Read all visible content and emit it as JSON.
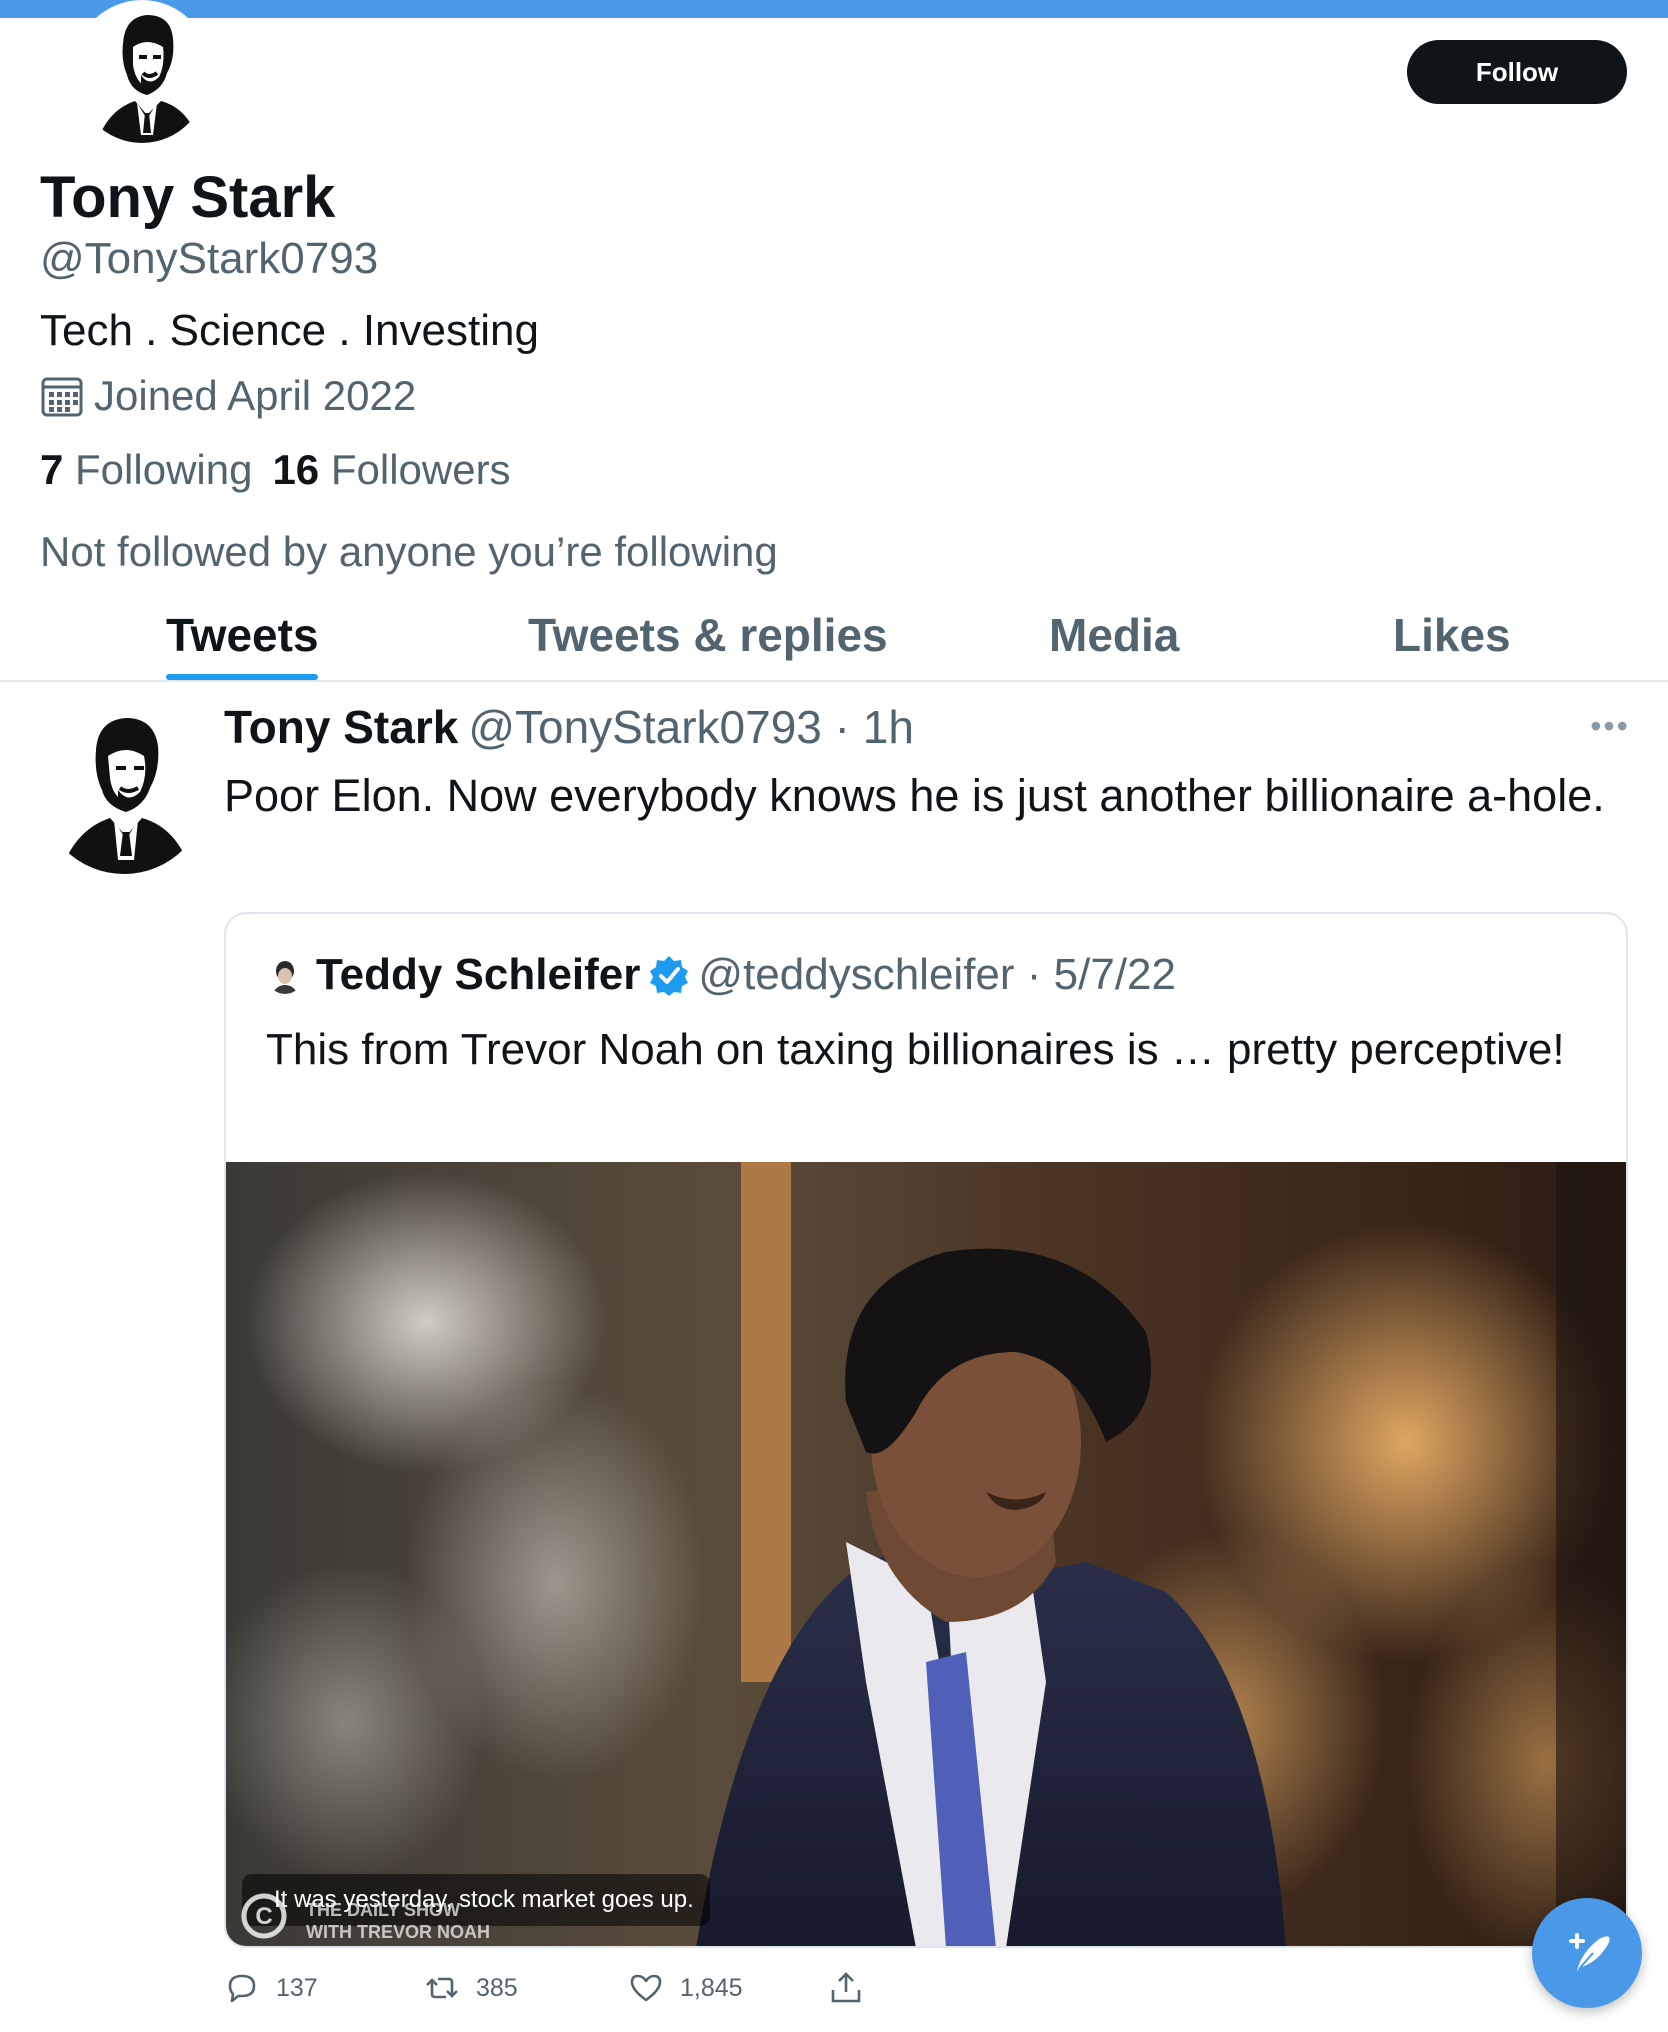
{
  "profile": {
    "display_name": "Tony Stark",
    "handle": "@TonyStark0793",
    "bio": "Tech . Science . Investing",
    "joined": "Joined April 2022",
    "following_count": "7",
    "following_label": "Following",
    "followers_count": "16",
    "followers_label": "Followers",
    "not_followed": "Not followed by anyone you’re following",
    "follow_label": "Follow"
  },
  "tabs": [
    {
      "label": "Tweets",
      "active": true
    },
    {
      "label": "Tweets & replies",
      "active": false
    },
    {
      "label": "Media",
      "active": false
    },
    {
      "label": "Likes",
      "active": false
    }
  ],
  "tweet": {
    "name": "Tony Stark",
    "handle_time": "@TonyStark0793 · 1h",
    "text": "Poor Elon. Now everybody knows he is just another billionaire a-hole.",
    "quote": {
      "name": "Teddy Schleifer",
      "handle_date": "@teddyschleifer · 5/7/22",
      "text": "This from Trevor Noah on taxing billionaires is … pretty perceptive!",
      "caption": "It was yesterday, stock market goes up.",
      "watermark": "THE DAILY SHOW WITH TREVOR NOAH"
    },
    "actions": {
      "reply_count": "137",
      "retweet_count": "385",
      "like_count": "1,845"
    }
  },
  "colors": {
    "accent": "#1d9bf0",
    "banner": "#4a99e9",
    "text_primary": "#0f1419",
    "text_secondary": "#536471"
  },
  "icons": [
    "calendar-icon",
    "more-icon",
    "verified-icon",
    "reply-icon",
    "retweet-icon",
    "like-icon",
    "share-icon",
    "compose-tweet-icon"
  ]
}
